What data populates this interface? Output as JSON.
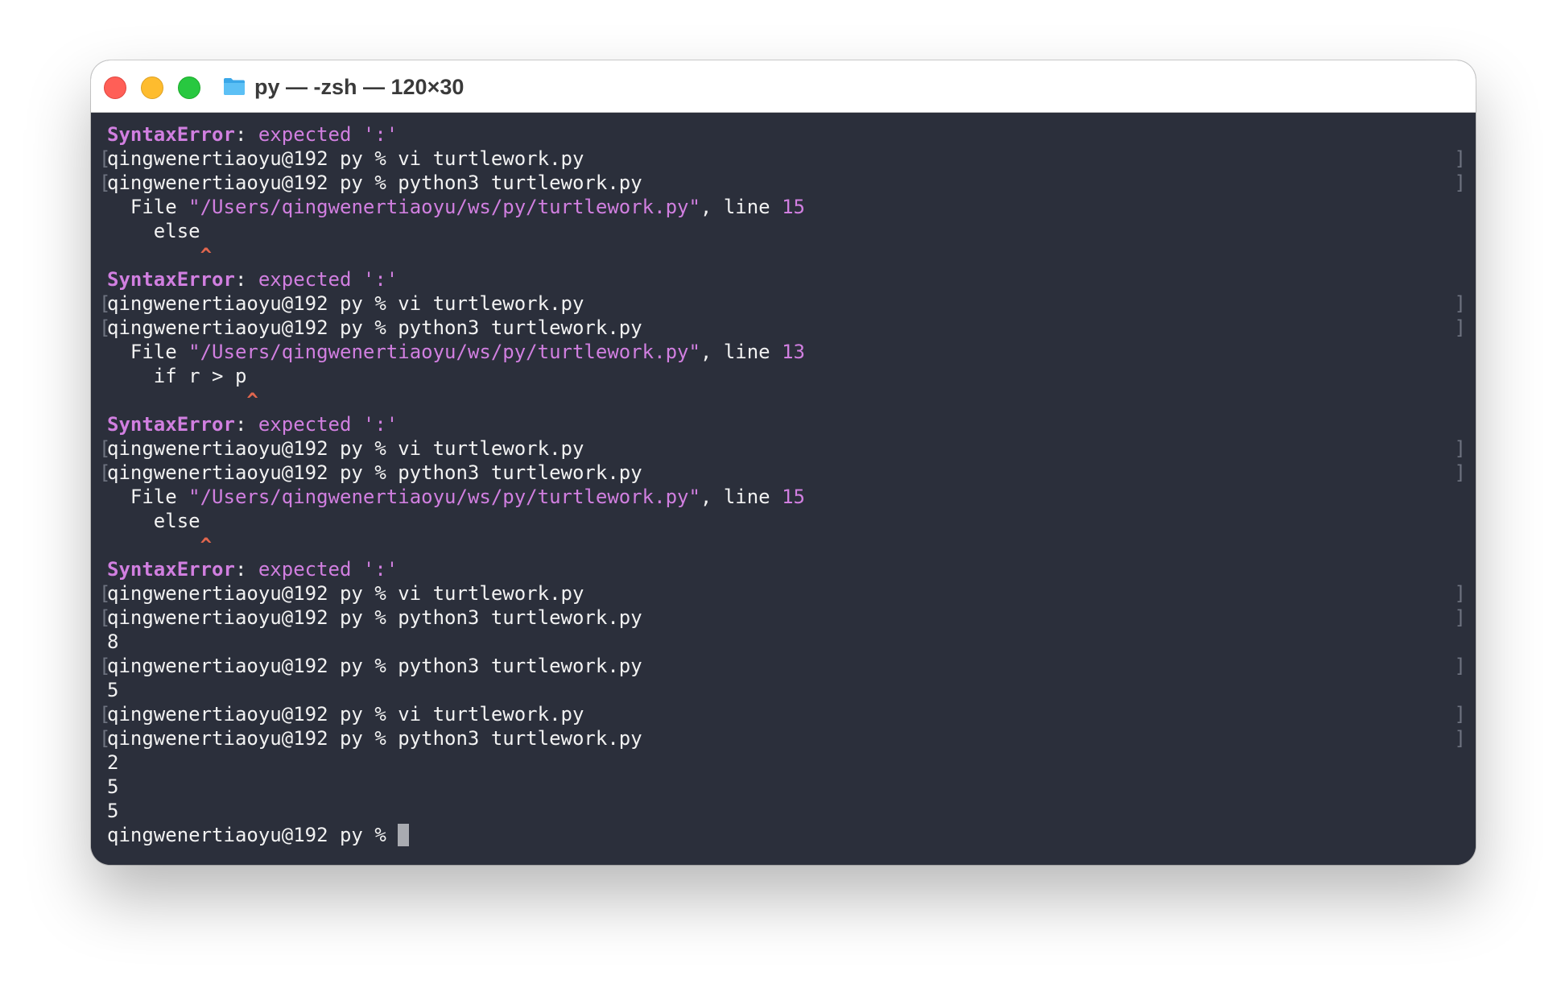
{
  "window": {
    "title": "py — -zsh — 120×30"
  },
  "terminal": {
    "lines": [
      {
        "kind": "syntax_error",
        "name": "SyntaxError",
        "sep": ": ",
        "message": "expected ':'"
      },
      {
        "kind": "prompt",
        "text": "qingwenertiaoyu@192 py % vi turtlework.py"
      },
      {
        "kind": "prompt",
        "text": "qingwenertiaoyu@192 py % python3 turtlework.py"
      },
      {
        "kind": "file_ref",
        "prefix": "  File ",
        "path": "\"/Users/qingwenertiaoyu/ws/py/turtlework.py\"",
        "mid": ", line ",
        "line_no": "15"
      },
      {
        "kind": "code",
        "text": "    else"
      },
      {
        "kind": "caret",
        "text": "        ^"
      },
      {
        "kind": "syntax_error",
        "name": "SyntaxError",
        "sep": ": ",
        "message": "expected ':'"
      },
      {
        "kind": "prompt",
        "text": "qingwenertiaoyu@192 py % vi turtlework.py"
      },
      {
        "kind": "prompt",
        "text": "qingwenertiaoyu@192 py % python3 turtlework.py"
      },
      {
        "kind": "file_ref",
        "prefix": "  File ",
        "path": "\"/Users/qingwenertiaoyu/ws/py/turtlework.py\"",
        "mid": ", line ",
        "line_no": "13"
      },
      {
        "kind": "code",
        "text": "    if r > p"
      },
      {
        "kind": "caret",
        "text": "            ^"
      },
      {
        "kind": "syntax_error",
        "name": "SyntaxError",
        "sep": ": ",
        "message": "expected ':'"
      },
      {
        "kind": "prompt",
        "text": "qingwenertiaoyu@192 py % vi turtlework.py"
      },
      {
        "kind": "prompt",
        "text": "qingwenertiaoyu@192 py % python3 turtlework.py"
      },
      {
        "kind": "file_ref",
        "prefix": "  File ",
        "path": "\"/Users/qingwenertiaoyu/ws/py/turtlework.py\"",
        "mid": ", line ",
        "line_no": "15"
      },
      {
        "kind": "code",
        "text": "    else"
      },
      {
        "kind": "caret",
        "text": "        ^"
      },
      {
        "kind": "syntax_error",
        "name": "SyntaxError",
        "sep": ": ",
        "message": "expected ':'"
      },
      {
        "kind": "prompt",
        "text": "qingwenertiaoyu@192 py % vi turtlework.py"
      },
      {
        "kind": "prompt",
        "text": "qingwenertiaoyu@192 py % python3 turtlework.py"
      },
      {
        "kind": "output",
        "text": "8"
      },
      {
        "kind": "prompt",
        "text": "qingwenertiaoyu@192 py % python3 turtlework.py"
      },
      {
        "kind": "output",
        "text": "5"
      },
      {
        "kind": "prompt",
        "text": "qingwenertiaoyu@192 py % vi turtlework.py"
      },
      {
        "kind": "prompt",
        "text": "qingwenertiaoyu@192 py % python3 turtlework.py"
      },
      {
        "kind": "output",
        "text": "2"
      },
      {
        "kind": "output",
        "text": "5"
      },
      {
        "kind": "output",
        "text": "5"
      },
      {
        "kind": "active_prompt",
        "text": "qingwenertiaoyu@192 py % "
      }
    ],
    "bracket_left": "[",
    "bracket_right": "]"
  },
  "icons": {
    "close": "close-window-button",
    "minimize": "minimize-window-button",
    "maximize": "zoom-window-button",
    "title_icon": "folder-icon"
  },
  "colors": {
    "terminal_bg": "#2b2f3b",
    "error_purple": "#d17fe0",
    "caret_red": "#e0664e",
    "text": "#f2f2f2"
  }
}
